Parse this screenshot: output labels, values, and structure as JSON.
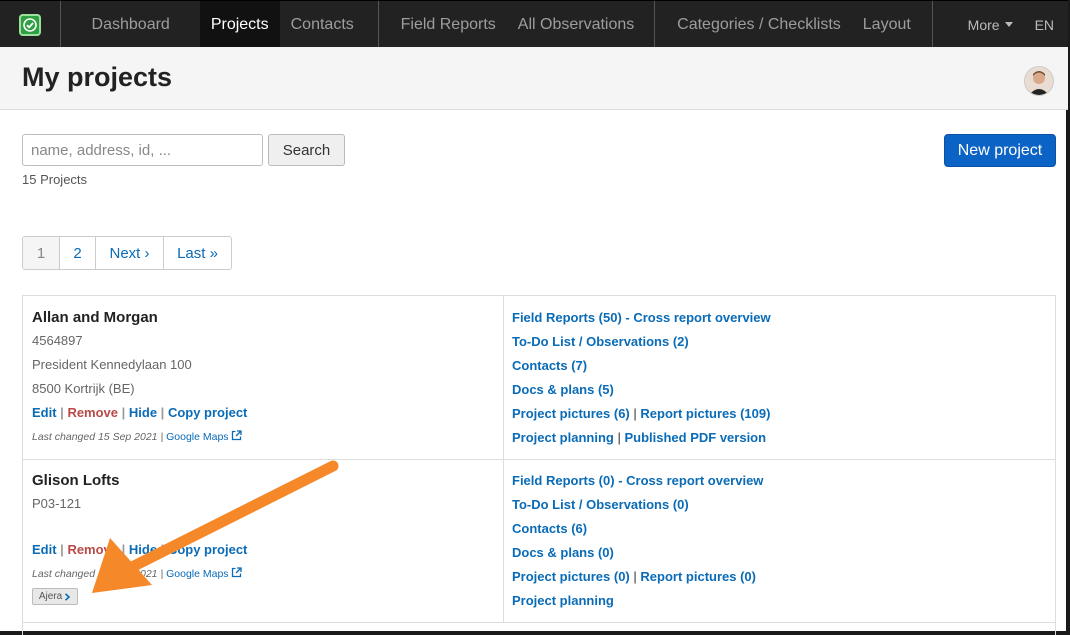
{
  "nav": {
    "items": [
      {
        "label": "Dashboard",
        "active": false
      },
      {
        "label": "Projects",
        "active": true
      },
      {
        "label": "Contacts",
        "active": false
      },
      {
        "label": "Field Reports",
        "active": false
      },
      {
        "label": "All Observations",
        "active": false
      },
      {
        "label": "Categories / Checklists",
        "active": false
      },
      {
        "label": "Layout",
        "active": false
      }
    ],
    "more_label": "More",
    "lang_label": "EN"
  },
  "header": {
    "title": "My projects"
  },
  "search": {
    "placeholder": "name, address, id, ...",
    "value": "",
    "button_label": "Search"
  },
  "project_count": "15 Projects",
  "new_project_label": "New project",
  "pagination": {
    "pages": [
      "1",
      "2"
    ],
    "current": "1",
    "next_label": "Next ›",
    "last_label": "Last »"
  },
  "projects": [
    {
      "name": "Allan and Morgan",
      "id": "4564897",
      "address_line1": "President Kennedylaan 100",
      "address_line2": "8500 Kortrijk (BE)",
      "actions": {
        "edit": "Edit",
        "remove": "Remove",
        "hide": "Hide",
        "copy": "Copy project"
      },
      "last_changed": "Last changed 15 Sep 2021",
      "maps_label": "Google Maps",
      "links": {
        "field_reports": "Field Reports (50)",
        "cross_report": "Cross report overview",
        "todo": "To-Do List / Observations (2)",
        "contacts": "Contacts (7)",
        "docs": "Docs & plans (5)",
        "project_pictures": "Project pictures (6)",
        "report_pictures": "Report pictures (109)",
        "planning": "Project planning",
        "published_pdf": "Published PDF version"
      }
    },
    {
      "name": "Glison Lofts",
      "id": "P03-121",
      "actions": {
        "edit": "Edit",
        "remove": "Remove",
        "hide": "Hide",
        "copy": "Copy project"
      },
      "last_changed": "Last changed 15 Sep 2021",
      "maps_label": "Google Maps",
      "badge": "Ajera",
      "links": {
        "field_reports": "Field Reports (0)",
        "cross_report": "Cross report overview",
        "todo": "To-Do List / Observations (0)",
        "contacts": "Contacts (6)",
        "docs": "Docs & plans (0)",
        "project_pictures": "Project pictures (0)",
        "report_pictures": "Report pictures (0)",
        "planning": "Project planning"
      }
    }
  ],
  "colors": {
    "accent": "#0b63c5",
    "link": "#0a6bb7",
    "remove": "#b94a48",
    "annotation_arrow": "#f5892a"
  }
}
